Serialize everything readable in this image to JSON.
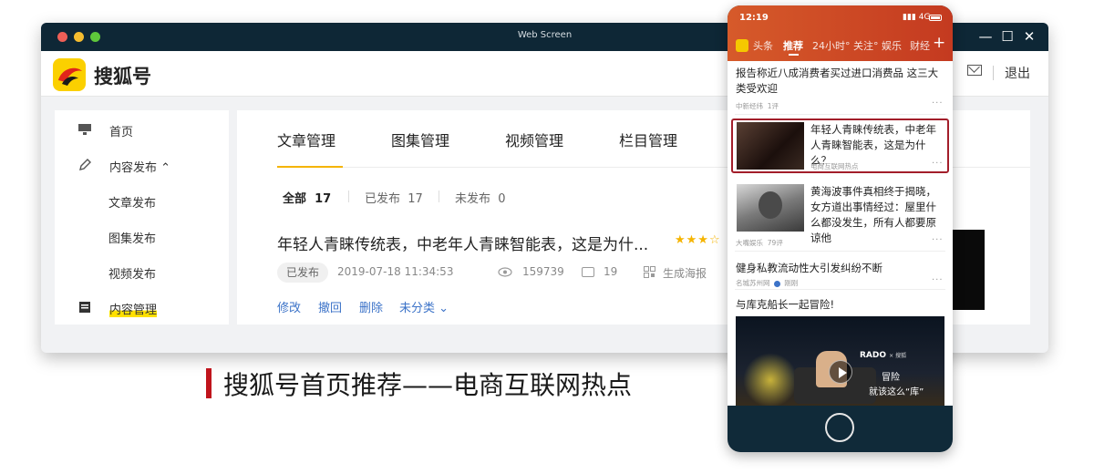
{
  "window": {
    "title": "Web Screen",
    "controls": {
      "minimize": "—",
      "maximize": "☐",
      "close": "✕"
    }
  },
  "brand": {
    "name": "搜狐号"
  },
  "header": {
    "logout": "退出"
  },
  "sidebar": {
    "items": [
      {
        "label": "首页",
        "icon": "monitor-icon"
      },
      {
        "label": "内容发布",
        "icon": "pen-icon",
        "expand": "⌃"
      },
      {
        "label": "文章发布"
      },
      {
        "label": "图集发布"
      },
      {
        "label": "视频发布"
      },
      {
        "label": "内容管理",
        "icon": "doc-icon"
      }
    ]
  },
  "main": {
    "tabs": [
      "文章管理",
      "图集管理",
      "视频管理",
      "栏目管理"
    ],
    "filters": [
      {
        "label": "全部",
        "count": "17"
      },
      {
        "label": "已发布",
        "count": "17"
      },
      {
        "label": "未发布",
        "count": "0"
      }
    ],
    "article": {
      "title": "年轻人青睐传统表，中老年人青睐智能表，这是为什...",
      "stars": "★★★☆",
      "status": "已发布",
      "datetime": "2019-07-18 11:34:53",
      "views": "159739",
      "comments": "19",
      "poster": "生成海报",
      "actions": [
        "修改",
        "撤回",
        "删除",
        "未分类 ⌄"
      ]
    }
  },
  "caption": "搜狐号首页推荐——电商互联网热点",
  "phone": {
    "time": "12:19",
    "signal": "4G",
    "tabs": [
      "头条",
      "推荐",
      "24小时°",
      "关注°",
      "娱乐",
      "财经"
    ],
    "active_tab": "推荐",
    "plus": "+",
    "feed": [
      {
        "title": "报告称近八成消费者买过进口消费品 这三大类受欢迎",
        "source": "中新经纬",
        "comments": "1评"
      },
      {
        "title": "年轻人青睐传统表，中老年人青睐智能表，这是为什么？",
        "source": "电商互联网热点"
      },
      {
        "title": "黄海波事件真相终于揭晓，女方道出事情经过：屋里什么都没发生，所有人都要原谅他",
        "source": "大嘴娱乐",
        "comments": "79评"
      },
      {
        "title": "健身私教流动性大引发纠纷不断",
        "source": "名城苏州网",
        "time": "刚刚"
      },
      {
        "title": "与库克船长一起冒险!"
      }
    ],
    "video": {
      "brand": "RADO",
      "brand_sub": "× 搜狐",
      "line1": "冒险",
      "line2": "就该这么“库”"
    },
    "more": "···"
  }
}
